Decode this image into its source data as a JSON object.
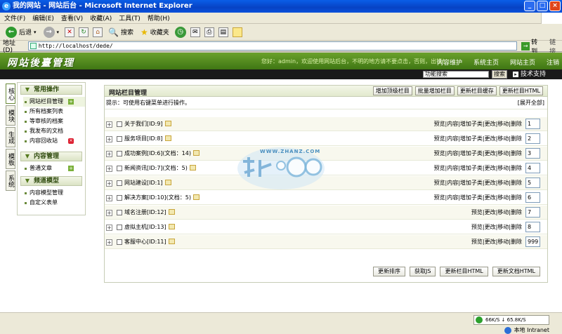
{
  "window": {
    "title": "我的网站 - 网站后台 - Microsoft Internet Explorer",
    "controls": {
      "minimize": "_",
      "maximize": "□",
      "close": "×"
    }
  },
  "menu": [
    "文件(F)",
    "编辑(E)",
    "查看(V)",
    "收藏(A)",
    "工具(T)",
    "帮助(H)"
  ],
  "toolbar": {
    "back": "后退",
    "search": "搜索",
    "favorites": "收藏夹"
  },
  "address": {
    "label": "地址(D)",
    "url": "http://localhost/dede/",
    "go": "转到",
    "links": "链接"
  },
  "header": {
    "logo": "网站後臺管理",
    "welcome": "您好：admin，欢迎使用网站后台，不明的地方请不要点击，否则，出错！",
    "nav": [
      "内容维护",
      "系统主页",
      "网站主页",
      "注销"
    ],
    "search_value": "功能搜索",
    "search_button": "搜索",
    "support": "技术支持"
  },
  "vtabs": [
    "核心",
    "模块",
    "生成",
    "模板",
    "系统"
  ],
  "sidebar": {
    "groups": [
      {
        "title": "常用操作",
        "items": [
          {
            "label": "网站栏目管理",
            "badge": "add"
          },
          {
            "label": "所有档案列表"
          },
          {
            "label": "等审核的档案"
          },
          {
            "label": "我发布的文档"
          },
          {
            "label": "内容回收站",
            "badge": "del"
          }
        ]
      },
      {
        "title": "内容管理",
        "items": [
          {
            "label": "普通文章",
            "badge": "add"
          }
        ]
      },
      {
        "title": "频道模型",
        "items": [
          {
            "label": "内容模型管理"
          },
          {
            "label": "自定义表单"
          }
        ]
      }
    ]
  },
  "main": {
    "title": "网站栏目管理",
    "buttons": [
      "增加顶级栏目",
      "批量增加栏目",
      "更新栏目缓存",
      "更新栏目HTML"
    ],
    "hint": "提示：可使用右键菜单进行操作。",
    "expand_all": "[展开全部]",
    "ops_full": "预览|内容|增加子类|更改|移动|删除",
    "ops_short": "预览|更改|移动|删除",
    "rows": [
      {
        "name": "关于我们[ID:9]",
        "order": "1",
        "full": true
      },
      {
        "name": "服务项目[ID:8]",
        "order": "2",
        "full": true
      },
      {
        "name": "成功案例[ID:6](文档：14)",
        "order": "3",
        "full": true
      },
      {
        "name": "新闻资讯[ID:7](文档：5)",
        "order": "4",
        "full": true
      },
      {
        "name": "网站建设[ID:1]",
        "order": "5",
        "full": true
      },
      {
        "name": "解决方案[ID:10](文档：5)",
        "order": "6",
        "full": true
      },
      {
        "name": "域名注册[ID:12]",
        "order": "7",
        "full": false
      },
      {
        "name": "虚拟主机[ID:13]",
        "order": "8",
        "full": false
      },
      {
        "name": "客服中心[ID:11]",
        "order": "999",
        "full": false
      }
    ],
    "bottom_buttons": [
      "更新排序",
      "获取JS",
      "更新栏目HTML",
      "更新文档HTML"
    ]
  },
  "watermark": {
    "text": "WWW.ZHANZ.COM"
  },
  "status": {
    "speed": "66K/S ↓ 65.8K/S",
    "zone": "本地 Intranet"
  }
}
